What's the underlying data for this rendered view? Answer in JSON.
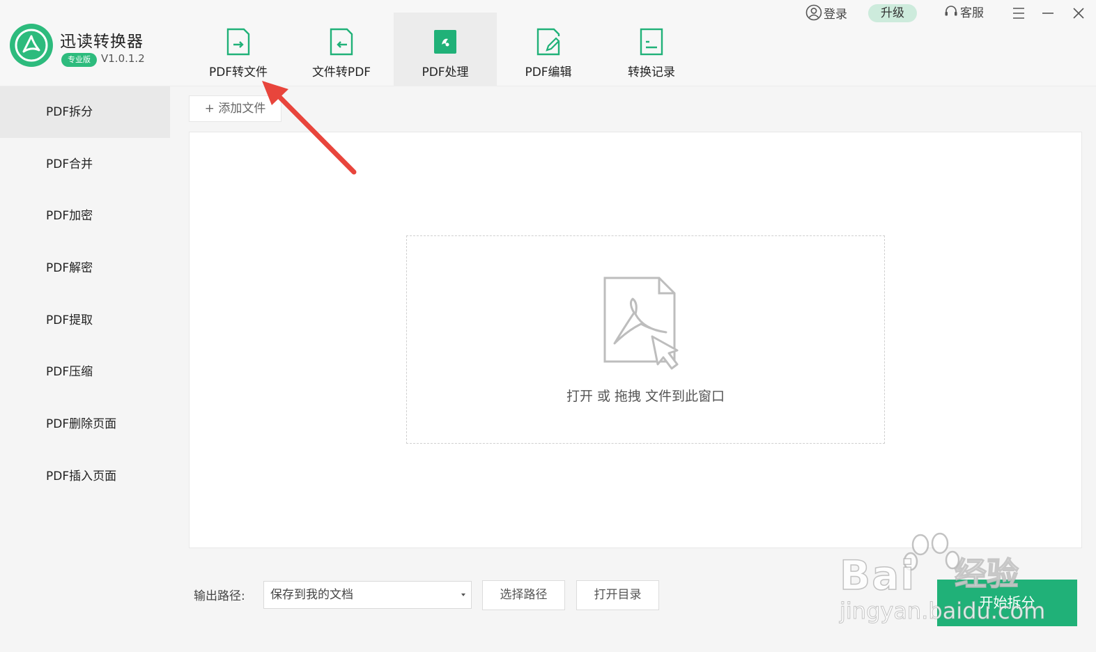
{
  "app": {
    "title": "迅读转换器",
    "edition_badge": "专业版",
    "version": "V1.0.1.2",
    "logo_icon": "pdf-acrobat-logo-icon",
    "brand_color": "#2dbb7d"
  },
  "main_tabs": [
    {
      "label": "PDF转文件",
      "icon": "pdf-to-file-icon",
      "active": false
    },
    {
      "label": "文件转PDF",
      "icon": "file-to-pdf-icon",
      "active": false
    },
    {
      "label": "PDF处理",
      "icon": "pdf-process-icon",
      "active": true
    },
    {
      "label": "PDF编辑",
      "icon": "pdf-edit-icon",
      "active": false
    },
    {
      "label": "转换记录",
      "icon": "conversion-history-icon",
      "active": false
    }
  ],
  "top_bar": {
    "login_label": "登录",
    "upgrade_label": "升级",
    "service_label": "客服"
  },
  "sidebar": {
    "items": [
      {
        "label": "PDF拆分",
        "active": true
      },
      {
        "label": "PDF合并",
        "active": false
      },
      {
        "label": "PDF加密",
        "active": false
      },
      {
        "label": "PDF解密",
        "active": false
      },
      {
        "label": "PDF提取",
        "active": false
      },
      {
        "label": "PDF压缩",
        "active": false
      },
      {
        "label": "PDF删除页面",
        "active": false
      },
      {
        "label": "PDF插入页面",
        "active": false
      }
    ]
  },
  "content": {
    "add_file_label": "+ 添加文件",
    "drop_text": "打开 或 拖拽 文件到此窗口"
  },
  "footer": {
    "output_label": "输出路径:",
    "path_value": "保存到我的文档",
    "choose_path_label": "选择路径",
    "open_dir_label": "打开目录",
    "start_label": "开始拆分"
  },
  "watermark": {
    "brand": "Bai",
    "brand_cn": "经验",
    "url": "jingyan.baidu.com"
  },
  "colors": {
    "accent": "#2dbb7d",
    "start_button": "#20b178",
    "arrow": "#e8453c"
  }
}
